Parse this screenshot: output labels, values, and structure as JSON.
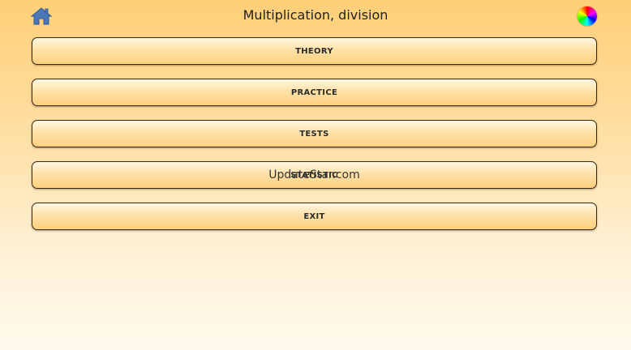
{
  "header": {
    "title": "Multiplication, division"
  },
  "menu": {
    "items": [
      {
        "label": "THEORY"
      },
      {
        "label": "PRACTICE"
      },
      {
        "label": "TESTS"
      },
      {
        "label": "STATISTIC"
      },
      {
        "label": "EXIT"
      }
    ]
  },
  "watermark": "UpdateStar.com",
  "icons": {
    "home": "home-icon",
    "color": "color-wheel-icon"
  },
  "colors": {
    "home_icon": "#4a78b8",
    "button_border": "#3a2a10"
  }
}
